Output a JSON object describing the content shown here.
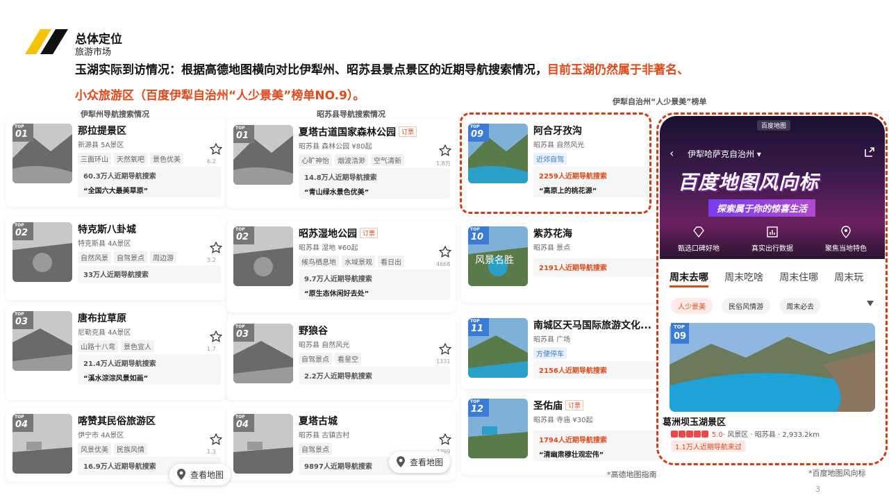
{
  "header": {
    "title": "总体定位",
    "subtitle": "旅游市场",
    "lead_line1": "玉湖实际到访情况：根据高德地图横向对比伊犁州、昭苏县景点景区的近期导航搜索情况，",
    "lead_line1_red": "目前玉湖仍然属于非著名、",
    "lead_line2_red": "小众旅游区（百度伊犁自治州“人少景美”榜单NO.9）。"
  },
  "captions": {
    "yili": "伊犁州导航搜索情况",
    "zhaosu": "昭苏县导航搜索情况",
    "baidu": "伊犁自治州“人少景美”榜单"
  },
  "top_label": "TOP",
  "yili_list": [
    {
      "rank": "01",
      "name": "那拉提景区",
      "meta": "新源县  5A景区",
      "tags": [
        "三面环山",
        "天然氧吧",
        "景色优美"
      ],
      "nav": "60.3万人近期导航搜索",
      "quote": "“全国六大最美草原”",
      "stars": "6.2"
    },
    {
      "rank": "02",
      "name": "特克斯八卦城",
      "meta": "特克斯县  4A景区",
      "tags": [
        "自然风景",
        "自驾景点",
        "周边游"
      ],
      "nav": "33万人近期导航搜索",
      "quote": "",
      "stars": "3.2"
    },
    {
      "rank": "03",
      "name": "唐布拉草原",
      "meta": "尼勒克县  4A景区",
      "tags": [
        "山路十八弯",
        "景色宜人"
      ],
      "nav": "21.4万人近期导航搜索",
      "quote": "“溪水淙淙风景如画”",
      "stars": "1.7"
    },
    {
      "rank": "04",
      "name": "喀赞其民俗旅游区",
      "meta": "伊宁市  4A景区",
      "tags": [
        "风景优美",
        "民族风情"
      ],
      "nav": "16.9万人近期导航搜索",
      "quote": "",
      "stars": "1.3"
    }
  ],
  "zhaosu_list": [
    {
      "rank": "01",
      "name": "夏塔古道国家森林公园",
      "order": "订票",
      "meta": "昭苏县  森林公园  ¥80起",
      "tags": [
        "心旷神怡",
        "烟波浩渺",
        "空气清新"
      ],
      "nav": "14.8万人近期导航搜索",
      "quote": "“青山绿水景色优美”",
      "stars": "1.8万"
    },
    {
      "rank": "02",
      "name": "昭苏湿地公园",
      "order": "订票",
      "meta": "昭苏县  湿地  ¥60起",
      "tags": [
        "候鸟栖息地",
        "水域景观",
        "看日出"
      ],
      "nav": "9.7万人近期导航搜索",
      "quote": "“原生态休闲好去处”",
      "stars": "4668"
    },
    {
      "rank": "03",
      "name": "野狼谷",
      "order": "",
      "meta": "昭苏县  自然风光",
      "tags": [
        "自驾景点",
        "看星空"
      ],
      "nav": "2.2万人近期导航搜索",
      "quote": "",
      "stars": "1331"
    },
    {
      "rank": "04",
      "name": "夏塔古城",
      "order": "",
      "meta": "昭苏县  古镇古村",
      "tags": [
        "自驾景点"
      ],
      "nav": "9897人近期导航搜索",
      "quote": "",
      "stars": "2399"
    }
  ],
  "baidu_list": [
    {
      "rank": "09",
      "name": "阿合牙孜沟",
      "order": "",
      "meta": "昭苏县  自然风光",
      "tags": [
        "近郊自驾"
      ],
      "nav": "2259人近期导航搜索",
      "quote": "“高原上的桃花源”"
    },
    {
      "rank": "10",
      "name": "紫苏花海",
      "order": "",
      "meta": "昭苏县  景点",
      "tags": [],
      "nav": "2191人近期导航搜索",
      "quote": "",
      "thumb_text": "风景名胜"
    },
    {
      "rank": "11",
      "name": "南城区天马国际旅游文化...",
      "order": "",
      "meta": "昭苏县  广场",
      "tags": [
        "方便停车"
      ],
      "nav": "2156人近期导航搜索",
      "quote": ""
    },
    {
      "rank": "12",
      "name": "圣佑庙",
      "order": "订票",
      "meta": "昭苏县  寺庙  ¥30起",
      "tags": [],
      "nav": "1794人近期导航搜索",
      "quote": "“清幽肃穆壮观宏伟”"
    }
  ],
  "map_button": "查看地图",
  "phone": {
    "brand": "百度地图",
    "region": "伊犁哈萨克自治州",
    "banner": "百度地图风向标",
    "slogan": "探索属于你的惊喜生活",
    "features": [
      "甄选口碑好地",
      "真实出行数据",
      "聚焦当地特色"
    ],
    "tabs": [
      "周末去哪",
      "周末吃啥",
      "周末住哪",
      "周末玩"
    ],
    "chips": [
      "人少景美",
      "民俗风情游",
      "周末必去"
    ],
    "rank": "09",
    "spot_name": "葛洲坝玉湖景区",
    "rating": "5.0",
    "rating_rest": "· 风景区 · 昭苏县 · 2,933.2km",
    "nav": "1.1万人近期导航来过"
  },
  "notes": {
    "gaode": "*高德地图指南",
    "baidu": "*百度地图风向标"
  },
  "page_number": "3",
  "colors": {
    "accent_red": "#e04a1a",
    "rank_blue": "#3a7bd5",
    "logo_yellow": "#f5c400"
  }
}
